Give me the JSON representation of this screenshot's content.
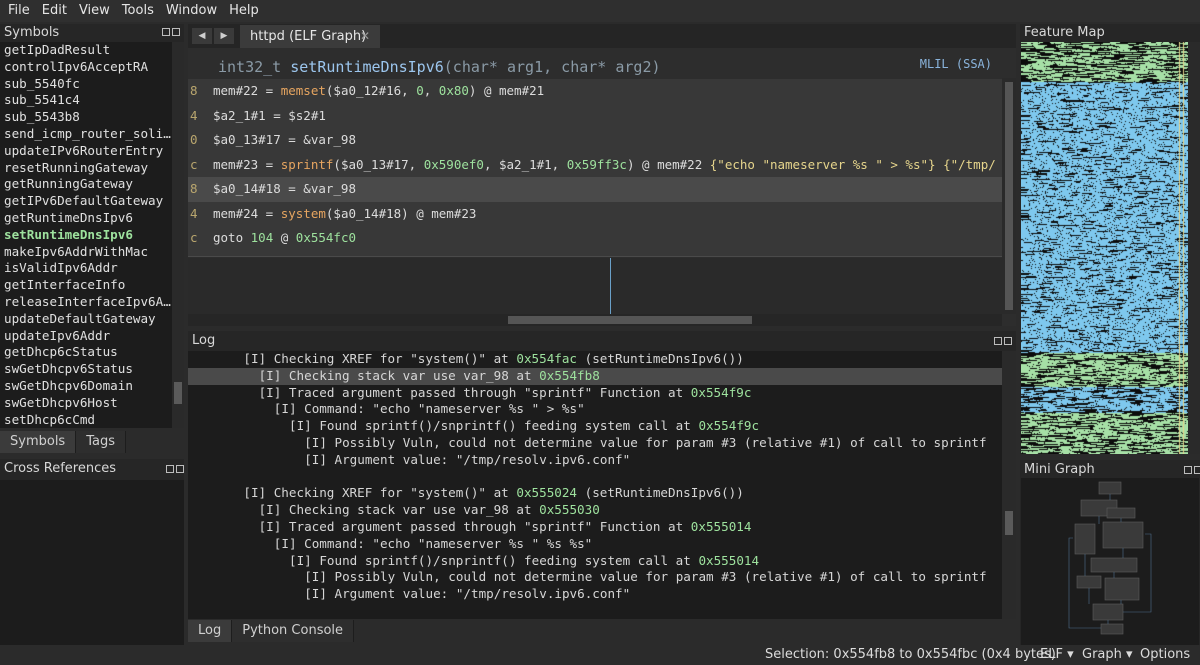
{
  "menu": [
    "File",
    "Edit",
    "View",
    "Tools",
    "Window",
    "Help"
  ],
  "symbols": {
    "title": "Symbols",
    "items": [
      "getIpDadResult",
      "controlIpv6AcceptRA",
      "sub_5540fc",
      "sub_5541c4",
      "sub_5543b8",
      "send_icmp_router_soli…",
      "updateIPv6RouterEntry",
      "resetRunningGateway",
      "getRunningGateway",
      "getIPv6DefaultGateway",
      "getRuntimeDnsIpv6",
      "setRuntimeDnsIpv6",
      "makeIpv6AddrWithMac",
      "isValidIpv6Addr",
      "getInterfaceInfo",
      "releaseInterfaceIpv6A…",
      "updateDefaultGateway",
      "updateIpv6Addr",
      "getDhcp6cStatus",
      "swGetDhcpv6Status",
      "swGetDhcpv6Domain",
      "swGetDhcpv6Host",
      "setDhcp6cCmd"
    ],
    "active": "setRuntimeDnsIpv6",
    "tabs": [
      "Symbols",
      "Tags"
    ]
  },
  "xrefs": {
    "title": "Cross References"
  },
  "tabbar": {
    "back": "◀",
    "forward": "▶",
    "doc_tab": "httpd (ELF Graph)",
    "close": "✕"
  },
  "graph": {
    "sig_prefix": "int32_t ",
    "sig_name": "setRuntimeDnsIpv6",
    "sig_args": "(char* arg1, char* arg2)",
    "il_label": "MLIL (SSA)",
    "lines": [
      {
        "gutter": "8",
        "parts": [
          [
            "t",
            "mem#22 = "
          ],
          [
            "fn",
            "memset"
          ],
          [
            "t",
            "($a0_12#16, "
          ],
          [
            "num",
            "0"
          ],
          [
            "t",
            ", "
          ],
          [
            "num",
            "0x80"
          ],
          [
            "t",
            ") @ mem#21"
          ]
        ]
      },
      {
        "gutter": "4",
        "parts": [
          [
            "t",
            "$a2_1#1 = $s2#1"
          ]
        ]
      },
      {
        "gutter": "0",
        "parts": [
          [
            "t",
            "$a0_13#17 = &var_98"
          ]
        ]
      },
      {
        "gutter": "c",
        "parts": [
          [
            "t",
            "mem#23 = "
          ],
          [
            "fn",
            "sprintf"
          ],
          [
            "t",
            "($a0_13#17, "
          ],
          [
            "num",
            "0x590ef0"
          ],
          [
            "t",
            ", $a2_1#1, "
          ],
          [
            "num",
            "0x59ff3c"
          ],
          [
            "t",
            ") @ mem#22  "
          ],
          [
            "str",
            "{\"echo \"nameserver %s \" > %s\"}"
          ],
          [
            "t",
            "  "
          ],
          [
            "str",
            "{\"/tmp/"
          ]
        ]
      },
      {
        "gutter": "8",
        "parts": [
          [
            "t",
            "$a0_14#18 = &var_98"
          ]
        ]
      },
      {
        "gutter": "4",
        "parts": [
          [
            "t",
            "mem#24 = "
          ],
          [
            "fn",
            "system"
          ],
          [
            "t",
            "($a0_14#18) @ mem#23"
          ]
        ]
      },
      {
        "gutter": "c",
        "parts": [
          [
            "t",
            "goto "
          ],
          [
            "num",
            "104"
          ],
          [
            "t",
            " @ "
          ],
          [
            "num",
            "0x554fc0"
          ]
        ]
      }
    ],
    "highlighted_line": 4
  },
  "log": {
    "title": "Log",
    "lines": [
      {
        "indent": 4,
        "text": "[I] Checking XREF for \"system()\" at ",
        "addr": "0x554fac",
        "tail": " (setRuntimeDnsIpv6())"
      },
      {
        "indent": 6,
        "text": "[I] Checking stack var use var_98 at ",
        "addr": "0x554fb8",
        "tail": ""
      },
      {
        "indent": 6,
        "text": "[I] Traced argument passed through \"sprintf\" Function at ",
        "addr": "0x554f9c",
        "tail": ""
      },
      {
        "indent": 8,
        "text": "[I] Command: \"echo \"nameserver %s \" > %s\"",
        "addr": "",
        "tail": ""
      },
      {
        "indent": 10,
        "text": "[I] Found sprintf()/snprintf() feeding system call at ",
        "addr": "0x554f9c",
        "tail": ""
      },
      {
        "indent": 12,
        "text": "[I] Possibly Vuln, could not determine value for param #3 (relative #1) of call to sprintf",
        "addr": "",
        "tail": ""
      },
      {
        "indent": 12,
        "text": "[I] Argument value: \"/tmp/resolv.ipv6.conf\"",
        "addr": "",
        "tail": ""
      },
      {
        "indent": 0,
        "text": "",
        "addr": "",
        "tail": ""
      },
      {
        "indent": 4,
        "text": "[I] Checking XREF for \"system()\" at ",
        "addr": "0x555024",
        "tail": " (setRuntimeDnsIpv6())"
      },
      {
        "indent": 6,
        "text": "[I] Checking stack var use var_98 at ",
        "addr": "0x555030",
        "tail": ""
      },
      {
        "indent": 6,
        "text": "[I] Traced argument passed through \"sprintf\" Function at ",
        "addr": "0x555014",
        "tail": ""
      },
      {
        "indent": 8,
        "text": "[I] Command: \"echo \"nameserver %s \" %s %s\"",
        "addr": "",
        "tail": ""
      },
      {
        "indent": 10,
        "text": "[I] Found sprintf()/snprintf() feeding system call at ",
        "addr": "0x555014",
        "tail": ""
      },
      {
        "indent": 12,
        "text": "[I] Possibly Vuln, could not determine value for param #3 (relative #1) of call to sprintf",
        "addr": "",
        "tail": ""
      },
      {
        "indent": 12,
        "text": "[I] Argument value: \"/tmp/resolv.ipv6.conf\"",
        "addr": "",
        "tail": ""
      }
    ],
    "highlighted_line": 1,
    "tabs": [
      "Log",
      "Python Console"
    ]
  },
  "feature_map": {
    "title": "Feature Map"
  },
  "mini_graph": {
    "title": "Mini Graph"
  },
  "status": {
    "selection": "Selection: 0x554fb8 to 0x554fbc (0x4 bytes)",
    "elf": "ELF ▾",
    "graph": "Graph ▾",
    "options": "Options ▾"
  },
  "colors": {
    "background": "#2b2b2b",
    "panel": "#1c1c1c",
    "address": "#9ee29e",
    "function_call": "#e6a560",
    "string": "#e6d58c",
    "feature_code": "#7ec8ee",
    "feature_data": "#a6e0a6"
  }
}
